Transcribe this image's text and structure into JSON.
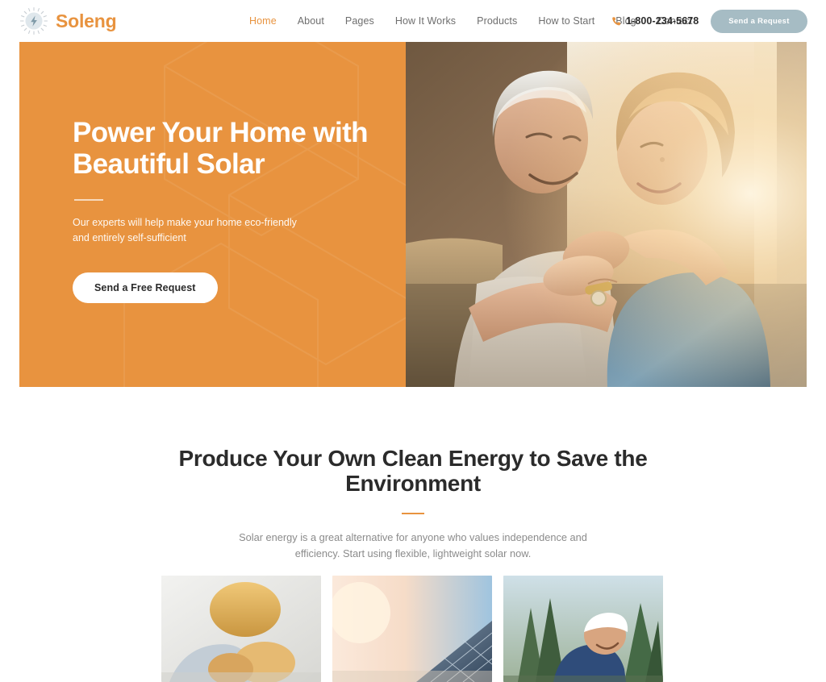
{
  "header": {
    "brand": {
      "name": "Soleng",
      "logo_icon": "sun-bolt-icon",
      "color": "#e8933f"
    },
    "nav": [
      {
        "label": "Home",
        "active": true
      },
      {
        "label": "About",
        "active": false
      },
      {
        "label": "Pages",
        "active": false
      },
      {
        "label": "How It Works",
        "active": false
      },
      {
        "label": "Products",
        "active": false
      },
      {
        "label": "How to Start",
        "active": false
      },
      {
        "label": "Blog",
        "active": false
      },
      {
        "label": "Contact",
        "active": false
      }
    ],
    "phone": {
      "icon": "phone-icon",
      "number": "1-800-234-5678"
    },
    "cta": {
      "label": "Send a Request",
      "color": "#a6bcc4"
    }
  },
  "hero": {
    "title": "Power Your Home with Beautiful Solar",
    "subtitle": "Our experts will help make your home eco-friendly and entirely self-sufficient",
    "button": "Send a Free Request",
    "background_color": "#e8933f",
    "photo_alt": "senior couple embracing on a sofa in warm sunlight"
  },
  "section": {
    "heading": "Produce Your Own Clean Energy to Save the Environment",
    "paragraph": "Solar energy is a great alternative for anyone who values independence and efficiency. Start using flexible, lightweight solar now.",
    "divider_color": "#e8933f",
    "cards": [
      {
        "alt": "technician inspecting solar equipment"
      },
      {
        "alt": "solar panel array at sunrise"
      },
      {
        "alt": "worker in white cap installing panels outdoors"
      }
    ]
  }
}
